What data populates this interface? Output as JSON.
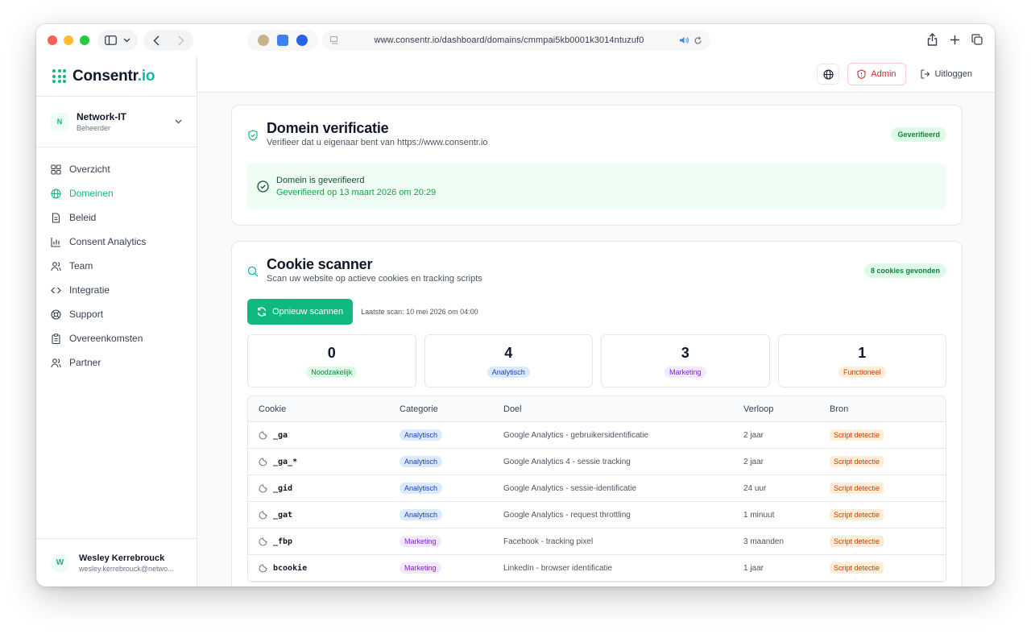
{
  "browser": {
    "url": "www.consentr.io/dashboard/domains/cmmpai5kb0001k3014ntuzuf0"
  },
  "sidebar": {
    "logo_main": "Consentr",
    "logo_accent": ".io",
    "org": {
      "initial": "N",
      "name": "Network-IT",
      "role": "Beheerder"
    },
    "items": [
      {
        "label": "Overzicht",
        "icon": "grid-icon"
      },
      {
        "label": "Domeinen",
        "icon": "globe-icon"
      },
      {
        "label": "Beleid",
        "icon": "document-icon"
      },
      {
        "label": "Consent Analytics",
        "icon": "bar-chart-icon"
      },
      {
        "label": "Team",
        "icon": "users-icon"
      },
      {
        "label": "Integratie",
        "icon": "code-icon"
      },
      {
        "label": "Support",
        "icon": "lifebuoy-icon"
      },
      {
        "label": "Overeenkomsten",
        "icon": "clipboard-icon"
      },
      {
        "label": "Partner",
        "icon": "users-icon"
      }
    ],
    "active_index": 1,
    "user": {
      "initial": "W",
      "name": "Wesley Kerrebrouck",
      "email": "wesley.kerrebrouck@netwo..."
    }
  },
  "topbar": {
    "admin_label": "Admin",
    "logout_label": "Uitloggen"
  },
  "verification": {
    "title": "Domein verificatie",
    "subtitle": "Verifieer dat u eigenaar bent van https://www.consentr.io",
    "badge": "Geverifieerd",
    "status_title": "Domein is geverifieerd",
    "status_date": "Geverifieerd op 13 maart 2026 om 20:29"
  },
  "scanner": {
    "title": "Cookie scanner",
    "subtitle": "Scan uw website op actieve cookies en tracking scripts",
    "badge": "8 cookies gevonden",
    "rescan_label": "Opnieuw scannen",
    "last_scan": "Laatste scan: 10 mei 2026 om 04:00",
    "stats": [
      {
        "count": "0",
        "label": "Noodzakelijk"
      },
      {
        "count": "4",
        "label": "Analytisch"
      },
      {
        "count": "3",
        "label": "Marketing"
      },
      {
        "count": "1",
        "label": "Functioneel"
      }
    ],
    "columns": [
      "Cookie",
      "Categorie",
      "Doel",
      "Verloop",
      "Bron"
    ],
    "rows": [
      {
        "cookie": "_ga",
        "category": "Analytisch",
        "purpose": "Google Analytics - gebruikersidentificatie",
        "expiry": "2 jaar",
        "source": "Script detectie"
      },
      {
        "cookie": "_ga_*",
        "category": "Analytisch",
        "purpose": "Google Analytics 4 - sessie tracking",
        "expiry": "2 jaar",
        "source": "Script detectie"
      },
      {
        "cookie": "_gid",
        "category": "Analytisch",
        "purpose": "Google Analytics - sessie-identificatie",
        "expiry": "24 uur",
        "source": "Script detectie"
      },
      {
        "cookie": "_gat",
        "category": "Analytisch",
        "purpose": "Google Analytics - request throttling",
        "expiry": "1 minuut",
        "source": "Script detectie"
      },
      {
        "cookie": "_fbp",
        "category": "Marketing",
        "purpose": "Facebook - tracking pixel",
        "expiry": "3 maanden",
        "source": "Script detectie"
      },
      {
        "cookie": "bcookie",
        "category": "Marketing",
        "purpose": "LinkedIn - browser identificatie",
        "expiry": "1 jaar",
        "source": "Script detectie"
      }
    ]
  },
  "colors": {
    "accent": "#10b981",
    "admin": "#dc2626"
  }
}
